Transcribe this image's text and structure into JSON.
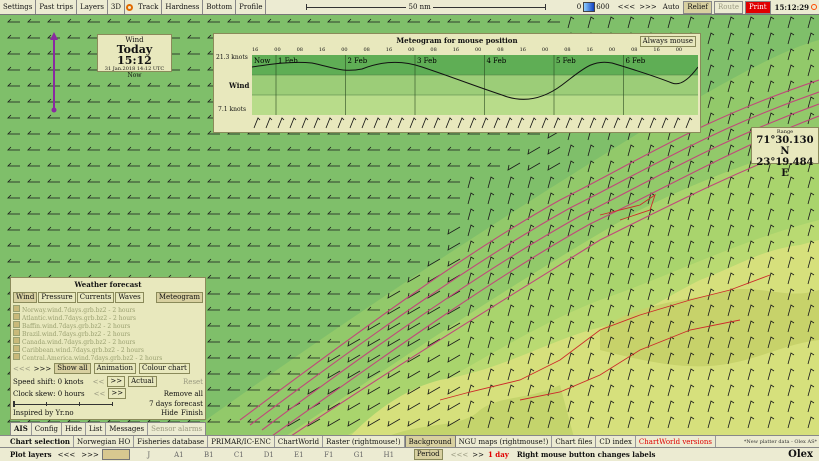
{
  "topbar": {
    "items": [
      "Settings",
      "Past trips",
      "Layers",
      "3D",
      "Track",
      "Hardness",
      "Bottom",
      "Profile"
    ],
    "scale_label": "50 nm",
    "depth_min": "0",
    "depth_max": "600",
    "nav_prev": "<<<",
    "nav_next": ">>>",
    "auto": "Auto",
    "relief": "Relief",
    "route": "Route",
    "print": "Print",
    "time": "15:12:29"
  },
  "wind_box": {
    "title": "Wind",
    "today": "Today 15:12",
    "date": "31 Jan.2018 14:12 UTC",
    "now": "Now"
  },
  "meteogram": {
    "title": "Meteogram for mouse position",
    "button": "Always mouse",
    "hours": [
      "16",
      "00",
      "08",
      "16",
      "00",
      "08",
      "16",
      "00",
      "08",
      "16",
      "00",
      "08",
      "16",
      "00",
      "08",
      "16",
      "00",
      "08",
      "16",
      "00"
    ],
    "max_label": "21.3 knots",
    "min_label": "7.1 knots",
    "row_label": "Wind",
    "days": [
      "Now",
      "1 Feb",
      "2 Feb",
      "3 Feb",
      "4 Feb",
      "5 Feb",
      "6 Feb"
    ]
  },
  "position": {
    "label": "Range",
    "lat": "71°30.130 N",
    "lon": "23°19.484 E"
  },
  "weather": {
    "title": "Weather forecast",
    "tabs": [
      "Wind",
      "Pressure",
      "Currents",
      "Waves"
    ],
    "meteogram_btn": "Meteogram",
    "layers": [
      "Norway.wind.7days.grb.bz2 - 2 hours",
      "Atlantic.wind.7days.grb.bz2 - 2 hours",
      "Baffin.wind.7days.grb.bz2 - 2 hours",
      "Brazil.wind.7days.grb.bz2 - 2 hours",
      "Canada.wind.7days.grb.bz2 - 2 hours",
      "Caribbean.wind.7days.grb.bz2 - 2 hours",
      "Central.America.wind.7days.grb.bz2 - 2 hours"
    ],
    "nav_prev": "<<<",
    "nav_next": ">>>",
    "show_all": "Show all",
    "animation": "Animation",
    "colour_chart": "Colour chart",
    "speed_shift": "Speed shift: 0 knots",
    "shift_prev": "<<",
    "shift_next": ">>",
    "actual": "Actual",
    "reset": "Reset",
    "clock_skew": "Clock skew: 0 hours",
    "remove_all": "Remove all",
    "forecast_range": "7 days forecast",
    "inspired": "Inspired by Yr.no",
    "hide": "Hide",
    "finish": "Finish"
  },
  "bar1": {
    "items": [
      "AIS",
      "Config",
      "Hide",
      "List",
      "Messages",
      "Sensor alarms"
    ]
  },
  "bar2": {
    "label": "Chart selection",
    "items": [
      "Norwegian HO",
      "Fisheries database",
      "PRIMAR/IC-ENC",
      "ChartWorld",
      "Raster (rightmouse!)",
      "Background",
      "NGU maps (rightmouse!)",
      "Chart files",
      "CD index",
      "ChartWorld versions"
    ],
    "credit": "*New platter data - Olex AS*"
  },
  "bar3": {
    "label": "Plot layers",
    "prev": "<<<",
    "next": ">>>",
    "layers": [
      "J",
      "A1",
      "B1",
      "C1",
      "D1",
      "E1",
      "F1",
      "G1",
      "H1"
    ],
    "period": "Period",
    "period_next": ">>",
    "day": "1 day",
    "hint": "Right mouse button changes labels",
    "brand": "Olex"
  },
  "colors": {
    "deep_sea": "#7fbf6a",
    "shallow_sea": "#a9d46d",
    "land": "#d6e07c",
    "panel": "#e8e8bd",
    "route": "#c0487a",
    "accent_red": "#e00000"
  }
}
